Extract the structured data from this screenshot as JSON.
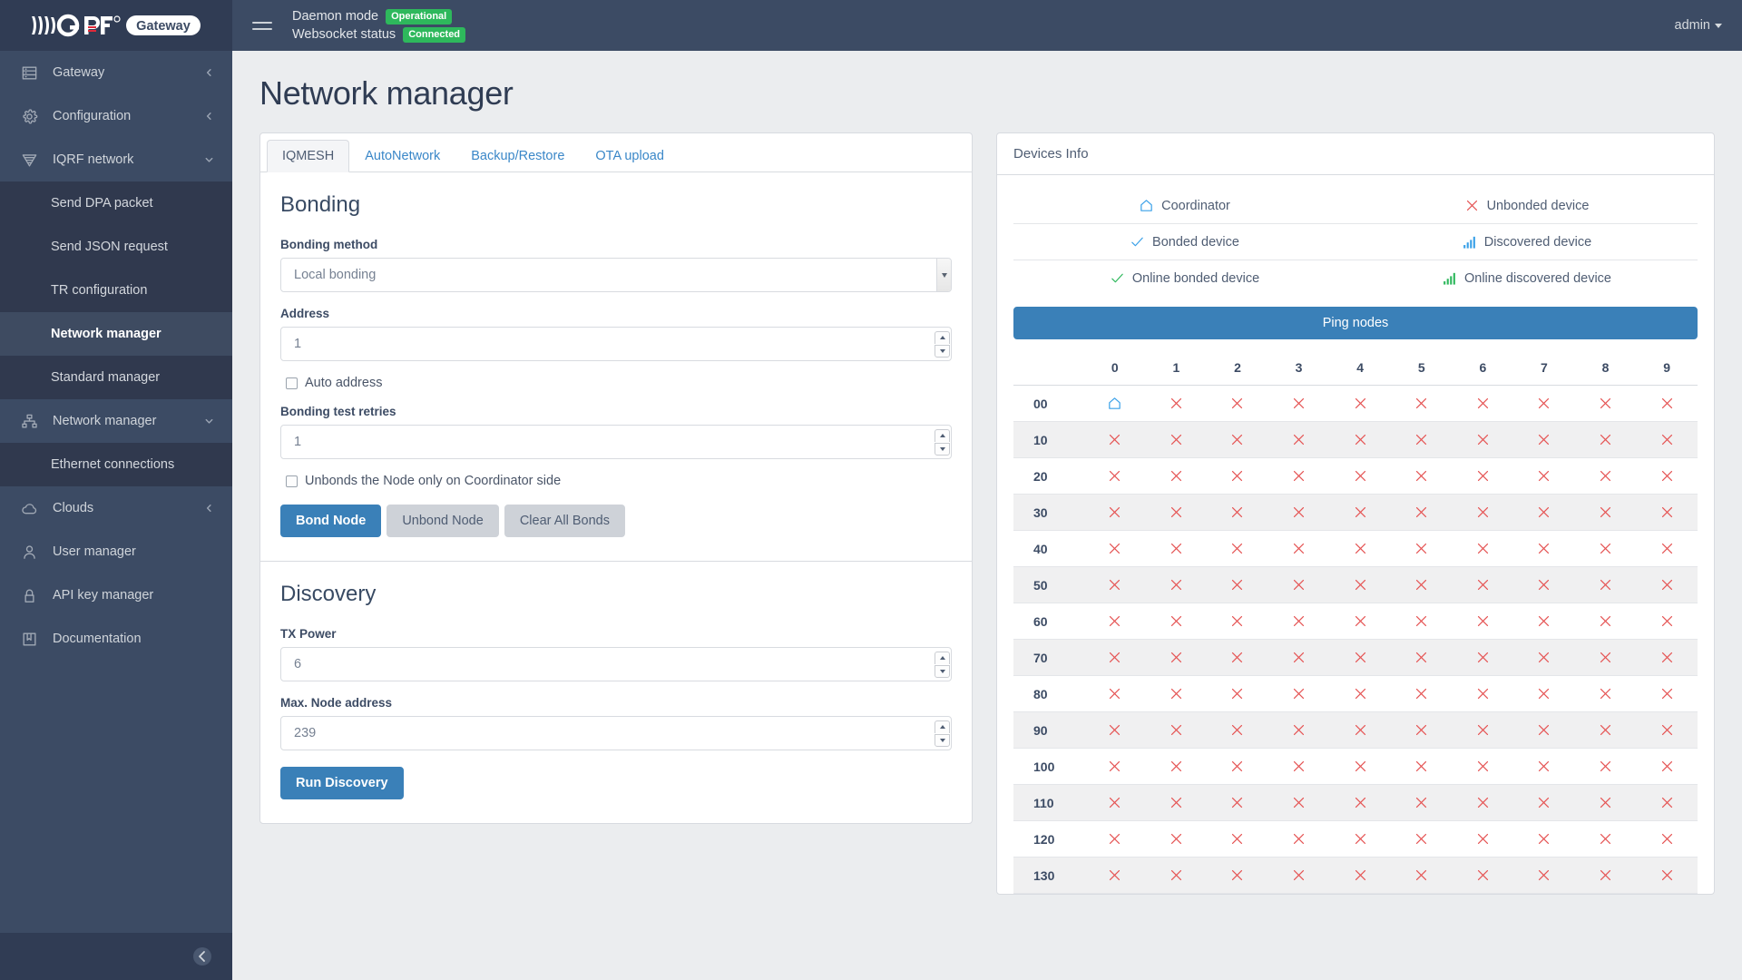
{
  "brand": {
    "logo_text": "Gateway",
    "logo_mark": "IQRF"
  },
  "header": {
    "daemon_label": "Daemon mode",
    "daemon_badge": "Operational",
    "websocket_label": "Websocket status",
    "websocket_badge": "Connected",
    "user": "admin",
    "badge_color": "#2eb85c"
  },
  "sidebar": {
    "items": [
      {
        "label": "Gateway",
        "icon": "gateway-icon",
        "type": "group",
        "chevron": "left",
        "active": false
      },
      {
        "label": "Configuration",
        "icon": "gear-icon",
        "type": "group",
        "chevron": "left",
        "active": false
      },
      {
        "label": "IQRF network",
        "icon": "iqrf-icon",
        "type": "group",
        "chevron": "down",
        "active": false
      },
      {
        "label": "Send DPA packet",
        "icon": "",
        "type": "child",
        "chevron": "",
        "active": false
      },
      {
        "label": "Send JSON request",
        "icon": "",
        "type": "child",
        "chevron": "",
        "active": false
      },
      {
        "label": "TR configuration",
        "icon": "",
        "type": "child",
        "chevron": "",
        "active": false
      },
      {
        "label": "Network manager",
        "icon": "",
        "type": "child",
        "chevron": "",
        "active": true
      },
      {
        "label": "Standard manager",
        "icon": "",
        "type": "child",
        "chevron": "",
        "active": false
      },
      {
        "label": "Network manager",
        "icon": "network-icon",
        "type": "group",
        "chevron": "down",
        "active": false
      },
      {
        "label": "Ethernet connections",
        "icon": "",
        "type": "child",
        "chevron": "",
        "active": false
      },
      {
        "label": "Clouds",
        "icon": "cloud-icon",
        "type": "group",
        "chevron": "left",
        "active": false
      },
      {
        "label": "User manager",
        "icon": "user-icon",
        "type": "group",
        "chevron": "",
        "active": false
      },
      {
        "label": "API key manager",
        "icon": "key-icon",
        "type": "group",
        "chevron": "",
        "active": false
      },
      {
        "label": "Documentation",
        "icon": "book-icon",
        "type": "group",
        "chevron": "",
        "active": false
      }
    ]
  },
  "page": {
    "title": "Network manager"
  },
  "tabs": [
    {
      "label": "IQMESH",
      "active": true
    },
    {
      "label": "AutoNetwork",
      "active": false
    },
    {
      "label": "Backup/Restore",
      "active": false
    },
    {
      "label": "OTA upload",
      "active": false
    }
  ],
  "bonding": {
    "title": "Bonding",
    "method_label": "Bonding method",
    "method_value": "Local bonding",
    "method_options": [
      "Local bonding"
    ],
    "address_label": "Address",
    "address_value": "1",
    "auto_address_label": "Auto address",
    "auto_address_checked": false,
    "retries_label": "Bonding test retries",
    "retries_value": "1",
    "coordinator_only_label": "Unbonds the Node only on Coordinator side",
    "coordinator_only_checked": false,
    "bond_button": "Bond Node",
    "unbond_button": "Unbond Node",
    "clear_button": "Clear All Bonds"
  },
  "discovery": {
    "title": "Discovery",
    "tx_power_label": "TX Power",
    "tx_power_value": "6",
    "max_addr_label": "Max. Node address",
    "max_addr_value": "239",
    "run_button": "Run Discovery"
  },
  "devices": {
    "card_title": "Devices Info",
    "legend": [
      [
        {
          "icon": "home-icon",
          "label": "Coordinator",
          "color": "#39a0e8"
        },
        {
          "icon": "x-icon",
          "label": "Unbonded device",
          "color": "#e55353"
        }
      ],
      [
        {
          "icon": "check-icon",
          "label": "Bonded device",
          "color": "#39a0e8"
        },
        {
          "icon": "signal-icon",
          "label": "Discovered device",
          "color": "#39a0e8"
        }
      ],
      [
        {
          "icon": "check-icon",
          "label": "Online bonded device",
          "color": "#2eb85c"
        },
        {
          "icon": "signal-icon",
          "label": "Online discovered device",
          "color": "#2eb85c"
        }
      ]
    ],
    "ping_button": "Ping nodes",
    "columns": [
      "0",
      "1",
      "2",
      "3",
      "4",
      "5",
      "6",
      "7",
      "8",
      "9"
    ],
    "rows": [
      {
        "label": "00",
        "cells": [
          "home-icon",
          "x-icon",
          "x-icon",
          "x-icon",
          "x-icon",
          "x-icon",
          "x-icon",
          "x-icon",
          "x-icon",
          "x-icon"
        ]
      },
      {
        "label": "10",
        "cells": [
          "x-icon",
          "x-icon",
          "x-icon",
          "x-icon",
          "x-icon",
          "x-icon",
          "x-icon",
          "x-icon",
          "x-icon",
          "x-icon"
        ]
      },
      {
        "label": "20",
        "cells": [
          "x-icon",
          "x-icon",
          "x-icon",
          "x-icon",
          "x-icon",
          "x-icon",
          "x-icon",
          "x-icon",
          "x-icon",
          "x-icon"
        ]
      },
      {
        "label": "30",
        "cells": [
          "x-icon",
          "x-icon",
          "x-icon",
          "x-icon",
          "x-icon",
          "x-icon",
          "x-icon",
          "x-icon",
          "x-icon",
          "x-icon"
        ]
      },
      {
        "label": "40",
        "cells": [
          "x-icon",
          "x-icon",
          "x-icon",
          "x-icon",
          "x-icon",
          "x-icon",
          "x-icon",
          "x-icon",
          "x-icon",
          "x-icon"
        ]
      },
      {
        "label": "50",
        "cells": [
          "x-icon",
          "x-icon",
          "x-icon",
          "x-icon",
          "x-icon",
          "x-icon",
          "x-icon",
          "x-icon",
          "x-icon",
          "x-icon"
        ]
      },
      {
        "label": "60",
        "cells": [
          "x-icon",
          "x-icon",
          "x-icon",
          "x-icon",
          "x-icon",
          "x-icon",
          "x-icon",
          "x-icon",
          "x-icon",
          "x-icon"
        ]
      },
      {
        "label": "70",
        "cells": [
          "x-icon",
          "x-icon",
          "x-icon",
          "x-icon",
          "x-icon",
          "x-icon",
          "x-icon",
          "x-icon",
          "x-icon",
          "x-icon"
        ]
      },
      {
        "label": "80",
        "cells": [
          "x-icon",
          "x-icon",
          "x-icon",
          "x-icon",
          "x-icon",
          "x-icon",
          "x-icon",
          "x-icon",
          "x-icon",
          "x-icon"
        ]
      },
      {
        "label": "90",
        "cells": [
          "x-icon",
          "x-icon",
          "x-icon",
          "x-icon",
          "x-icon",
          "x-icon",
          "x-icon",
          "x-icon",
          "x-icon",
          "x-icon"
        ]
      },
      {
        "label": "100",
        "cells": [
          "x-icon",
          "x-icon",
          "x-icon",
          "x-icon",
          "x-icon",
          "x-icon",
          "x-icon",
          "x-icon",
          "x-icon",
          "x-icon"
        ]
      },
      {
        "label": "110",
        "cells": [
          "x-icon",
          "x-icon",
          "x-icon",
          "x-icon",
          "x-icon",
          "x-icon",
          "x-icon",
          "x-icon",
          "x-icon",
          "x-icon"
        ]
      },
      {
        "label": "120",
        "cells": [
          "x-icon",
          "x-icon",
          "x-icon",
          "x-icon",
          "x-icon",
          "x-icon",
          "x-icon",
          "x-icon",
          "x-icon",
          "x-icon"
        ]
      },
      {
        "label": "130",
        "cells": [
          "x-icon",
          "x-icon",
          "x-icon",
          "x-icon",
          "x-icon",
          "x-icon",
          "x-icon",
          "x-icon",
          "x-icon",
          "x-icon"
        ]
      }
    ]
  },
  "colors": {
    "primary": "#3a80b8",
    "sidebar": "#3c4b64",
    "success": "#2eb85c",
    "danger": "#e55353"
  }
}
